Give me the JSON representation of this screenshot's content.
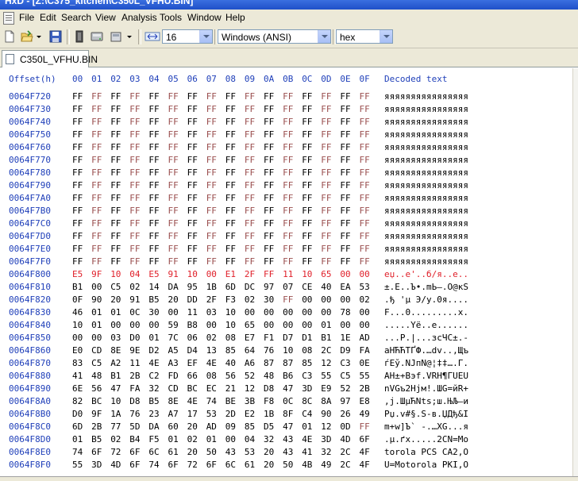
{
  "window": {
    "title": "HxD - [Z:\\C375_kitchen\\C350L_VFHU.BIN]"
  },
  "menu": [
    "File",
    "Edit",
    "Search",
    "View",
    "Analysis",
    "Tools",
    "Window",
    "Help"
  ],
  "toolbar": {
    "bytes_per_row": "16",
    "charset": "Windows (ANSI)",
    "display": "hex"
  },
  "tab": {
    "label": "C350L_VFHU.BIN"
  },
  "hex_header": {
    "offset": "Offset(h)",
    "columns": [
      "00",
      "01",
      "02",
      "03",
      "04",
      "05",
      "06",
      "07",
      "08",
      "09",
      "0A",
      "0B",
      "0C",
      "0D",
      "0E",
      "0F"
    ],
    "decoded": "Decoded text"
  },
  "rows": [
    {
      "offset": "0064F720",
      "bytes": [
        "FF",
        "FF",
        "FF",
        "FF",
        "FF",
        "FF",
        "FF",
        "FF",
        "FF",
        "FF",
        "FF",
        "FF",
        "FF",
        "FF",
        "FF",
        "FF"
      ],
      "text": "яяяяяяяяяяяяяяяя"
    },
    {
      "offset": "0064F730",
      "bytes": [
        "FF",
        "FF",
        "FF",
        "FF",
        "FF",
        "FF",
        "FF",
        "FF",
        "FF",
        "FF",
        "FF",
        "FF",
        "FF",
        "FF",
        "FF",
        "FF"
      ],
      "text": "яяяяяяяяяяяяяяяя"
    },
    {
      "offset": "0064F740",
      "bytes": [
        "FF",
        "FF",
        "FF",
        "FF",
        "FF",
        "FF",
        "FF",
        "FF",
        "FF",
        "FF",
        "FF",
        "FF",
        "FF",
        "FF",
        "FF",
        "FF"
      ],
      "text": "яяяяяяяяяяяяяяяя"
    },
    {
      "offset": "0064F750",
      "bytes": [
        "FF",
        "FF",
        "FF",
        "FF",
        "FF",
        "FF",
        "FF",
        "FF",
        "FF",
        "FF",
        "FF",
        "FF",
        "FF",
        "FF",
        "FF",
        "FF"
      ],
      "text": "яяяяяяяяяяяяяяяя"
    },
    {
      "offset": "0064F760",
      "bytes": [
        "FF",
        "FF",
        "FF",
        "FF",
        "FF",
        "FF",
        "FF",
        "FF",
        "FF",
        "FF",
        "FF",
        "FF",
        "FF",
        "FF",
        "FF",
        "FF"
      ],
      "text": "яяяяяяяяяяяяяяяя"
    },
    {
      "offset": "0064F770",
      "bytes": [
        "FF",
        "FF",
        "FF",
        "FF",
        "FF",
        "FF",
        "FF",
        "FF",
        "FF",
        "FF",
        "FF",
        "FF",
        "FF",
        "FF",
        "FF",
        "FF"
      ],
      "text": "яяяяяяяяяяяяяяяя"
    },
    {
      "offset": "0064F780",
      "bytes": [
        "FF",
        "FF",
        "FF",
        "FF",
        "FF",
        "FF",
        "FF",
        "FF",
        "FF",
        "FF",
        "FF",
        "FF",
        "FF",
        "FF",
        "FF",
        "FF"
      ],
      "text": "яяяяяяяяяяяяяяяя"
    },
    {
      "offset": "0064F790",
      "bytes": [
        "FF",
        "FF",
        "FF",
        "FF",
        "FF",
        "FF",
        "FF",
        "FF",
        "FF",
        "FF",
        "FF",
        "FF",
        "FF",
        "FF",
        "FF",
        "FF"
      ],
      "text": "яяяяяяяяяяяяяяяя"
    },
    {
      "offset": "0064F7A0",
      "bytes": [
        "FF",
        "FF",
        "FF",
        "FF",
        "FF",
        "FF",
        "FF",
        "FF",
        "FF",
        "FF",
        "FF",
        "FF",
        "FF",
        "FF",
        "FF",
        "FF"
      ],
      "text": "яяяяяяяяяяяяяяяя"
    },
    {
      "offset": "0064F7B0",
      "bytes": [
        "FF",
        "FF",
        "FF",
        "FF",
        "FF",
        "FF",
        "FF",
        "FF",
        "FF",
        "FF",
        "FF",
        "FF",
        "FF",
        "FF",
        "FF",
        "FF"
      ],
      "text": "яяяяяяяяяяяяяяяя"
    },
    {
      "offset": "0064F7C0",
      "bytes": [
        "FF",
        "FF",
        "FF",
        "FF",
        "FF",
        "FF",
        "FF",
        "FF",
        "FF",
        "FF",
        "FF",
        "FF",
        "FF",
        "FF",
        "FF",
        "FF"
      ],
      "text": "яяяяяяяяяяяяяяяя"
    },
    {
      "offset": "0064F7D0",
      "bytes": [
        "FF",
        "FF",
        "FF",
        "FF",
        "FF",
        "FF",
        "FF",
        "FF",
        "FF",
        "FF",
        "FF",
        "FF",
        "FF",
        "FF",
        "FF",
        "FF"
      ],
      "text": "яяяяяяяяяяяяяяяя"
    },
    {
      "offset": "0064F7E0",
      "bytes": [
        "FF",
        "FF",
        "FF",
        "FF",
        "FF",
        "FF",
        "FF",
        "FF",
        "FF",
        "FF",
        "FF",
        "FF",
        "FF",
        "FF",
        "FF",
        "FF"
      ],
      "text": "яяяяяяяяяяяяяяяя"
    },
    {
      "offset": "0064F7F0",
      "bytes": [
        "FF",
        "FF",
        "FF",
        "FF",
        "FF",
        "FF",
        "FF",
        "FF",
        "FF",
        "FF",
        "FF",
        "FF",
        "FF",
        "FF",
        "FF",
        "FF"
      ],
      "text": "яяяяяяяяяяяяяяяя"
    },
    {
      "offset": "0064F800",
      "bytes": [
        "E5",
        "9F",
        "10",
        "04",
        "E5",
        "91",
        "10",
        "00",
        "E1",
        "2F",
        "FF",
        "11",
        "10",
        "65",
        "00",
        "00"
      ],
      "text": "еџ..е'..б/я..е..",
      "highlight": true
    },
    {
      "offset": "0064F810",
      "bytes": [
        "B1",
        "00",
        "C5",
        "02",
        "14",
        "DA",
        "95",
        "1B",
        "6D",
        "DC",
        "97",
        "07",
        "CE",
        "40",
        "EA",
        "53"
      ],
      "text": "±.Е..Ъ•.mЬ—.О@кS"
    },
    {
      "offset": "0064F820",
      "bytes": [
        "0F",
        "90",
        "20",
        "91",
        "B5",
        "20",
        "DD",
        "2F",
        "F3",
        "02",
        "30",
        "FF",
        "00",
        "00",
        "00",
        "02"
      ],
      "text": ".ђ 'µ Э/у.0я...."
    },
    {
      "offset": "0064F830",
      "bytes": [
        "46",
        "01",
        "01",
        "0C",
        "30",
        "00",
        "11",
        "03",
        "10",
        "00",
        "00",
        "00",
        "00",
        "00",
        "78",
        "00"
      ],
      "text": "F...0.........x."
    },
    {
      "offset": "0064F840",
      "bytes": [
        "10",
        "01",
        "00",
        "00",
        "00",
        "59",
        "B8",
        "00",
        "10",
        "65",
        "00",
        "00",
        "00",
        "01",
        "00",
        "00"
      ],
      "text": ".....Yё..e......"
    },
    {
      "offset": "0064F850",
      "bytes": [
        "00",
        "00",
        "03",
        "D0",
        "01",
        "7C",
        "06",
        "02",
        "08",
        "E7",
        "F1",
        "D7",
        "D1",
        "B1",
        "1E",
        "AD"
      ],
      "text": "...Р.|...зсЧС±.-"
    },
    {
      "offset": "0064F860",
      "bytes": [
        "E0",
        "CD",
        "8E",
        "9E",
        "D2",
        "A5",
        "D4",
        "13",
        "85",
        "64",
        "76",
        "10",
        "08",
        "2C",
        "D9",
        "FA"
      ],
      "text": "аНЋЋТҐФ.…dv..,Щъ"
    },
    {
      "offset": "0064F870",
      "bytes": [
        "83",
        "C5",
        "A2",
        "11",
        "4E",
        "A3",
        "EF",
        "4E",
        "40",
        "A6",
        "87",
        "87",
        "85",
        "12",
        "C3",
        "0E"
      ],
      "text": "ѓЕў.NЈпN@¦‡‡….Г."
    },
    {
      "offset": "0064F880",
      "bytes": [
        "41",
        "48",
        "B1",
        "2B",
        "C2",
        "FD",
        "66",
        "08",
        "56",
        "52",
        "48",
        "B6",
        "C3",
        "55",
        "C5",
        "55"
      ],
      "text": "AH±+Вэf.VRH¶ГUЕU"
    },
    {
      "offset": "0064F890",
      "bytes": [
        "6E",
        "56",
        "47",
        "FA",
        "32",
        "CD",
        "BC",
        "EC",
        "21",
        "12",
        "D8",
        "47",
        "3D",
        "E9",
        "52",
        "2B"
      ],
      "text": "nVGъ2Нјм!.ШG=йR+"
    },
    {
      "offset": "0064F8A0",
      "bytes": [
        "82",
        "BC",
        "10",
        "D8",
        "B5",
        "8E",
        "4E",
        "74",
        "BE",
        "3B",
        "F8",
        "0C",
        "8C",
        "8A",
        "97",
        "E8"
      ],
      "text": "‚ј.ШµЋNtѕ;ш.ЊЉ—и"
    },
    {
      "offset": "0064F8B0",
      "bytes": [
        "D0",
        "9F",
        "1A",
        "76",
        "23",
        "A7",
        "17",
        "53",
        "2D",
        "E2",
        "1B",
        "8F",
        "C4",
        "90",
        "26",
        "49"
      ],
      "text": "Рџ.v#§.S-в.ЏДђ&I"
    },
    {
      "offset": "0064F8C0",
      "bytes": [
        "6D",
        "2B",
        "77",
        "5D",
        "DA",
        "60",
        "20",
        "AD",
        "09",
        "85",
        "D5",
        "47",
        "01",
        "12",
        "0D",
        "FF"
      ],
      "text": "m+w]Ъ` -.…ХG...я"
    },
    {
      "offset": "0064F8D0",
      "bytes": [
        "01",
        "B5",
        "02",
        "B4",
        "F5",
        "01",
        "02",
        "01",
        "00",
        "04",
        "32",
        "43",
        "4E",
        "3D",
        "4D",
        "6F"
      ],
      "text": ".µ.ґх.....2CN=Mo"
    },
    {
      "offset": "0064F8E0",
      "bytes": [
        "74",
        "6F",
        "72",
        "6F",
        "6C",
        "61",
        "20",
        "50",
        "43",
        "53",
        "20",
        "43",
        "41",
        "32",
        "2C",
        "4F"
      ],
      "text": "torola PCS CA2,O"
    },
    {
      "offset": "0064F8F0",
      "bytes": [
        "55",
        "3D",
        "4D",
        "6F",
        "74",
        "6F",
        "72",
        "6F",
        "6C",
        "61",
        "20",
        "50",
        "4B",
        "49",
        "2C",
        "4F"
      ],
      "text": "U=Motorola PKI,O"
    }
  ],
  "colors": {
    "offset": "#1f3fb9",
    "ff_byte": "#9a4e4e",
    "highlight": "#e0202a"
  },
  "icons": [
    "new-file-icon",
    "open-folder-icon",
    "save-icon",
    "ram-icon",
    "disk-icon",
    "open-disk-icon",
    "bytes-per-row-icon"
  ]
}
